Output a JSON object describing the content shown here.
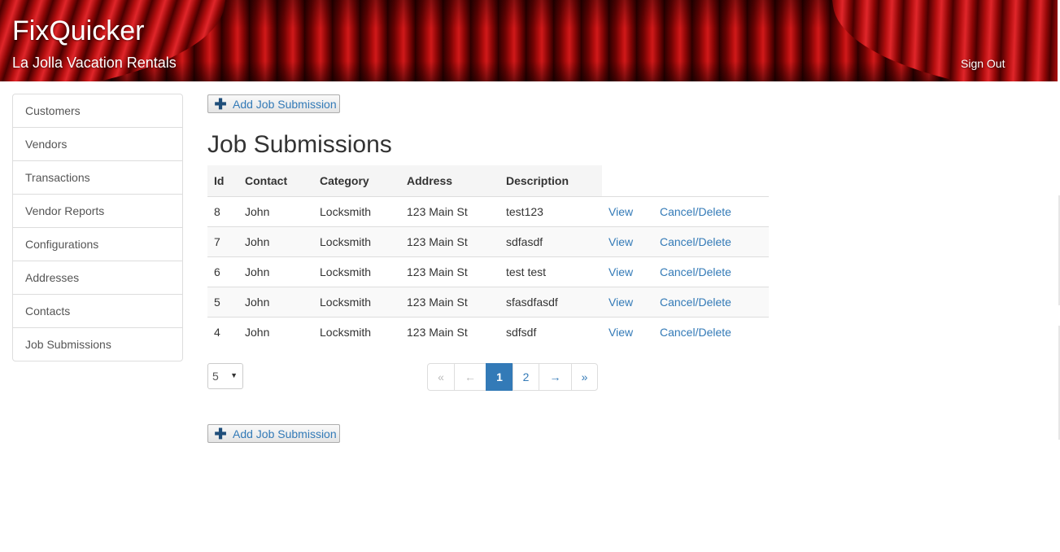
{
  "header": {
    "brand": "FixQuicker",
    "subtitle": "La Jolla Vacation Rentals",
    "signout_label": "Sign Out"
  },
  "sidebar": {
    "items": [
      {
        "label": "Customers"
      },
      {
        "label": "Vendors"
      },
      {
        "label": "Transactions"
      },
      {
        "label": "Vendor Reports"
      },
      {
        "label": "Configurations"
      },
      {
        "label": "Addresses"
      },
      {
        "label": "Contacts"
      },
      {
        "label": "Job Submissions"
      }
    ]
  },
  "main": {
    "add_button_label": "Add Job Submission",
    "title": "Job Submissions",
    "table": {
      "columns": [
        "Id",
        "Contact",
        "Category",
        "Address",
        "Description"
      ],
      "rows": [
        {
          "id": "8",
          "contact": "John",
          "category": "Locksmith",
          "address": "123 Main St",
          "description": "test123",
          "view": "View",
          "delete": "Cancel/Delete"
        },
        {
          "id": "7",
          "contact": "John",
          "category": "Locksmith",
          "address": "123 Main St",
          "description": "sdfasdf",
          "view": "View",
          "delete": "Cancel/Delete"
        },
        {
          "id": "6",
          "contact": "John",
          "category": "Locksmith",
          "address": "123 Main St",
          "description": "test test",
          "view": "View",
          "delete": "Cancel/Delete"
        },
        {
          "id": "5",
          "contact": "John",
          "category": "Locksmith",
          "address": "123 Main St",
          "description": "sfasdfasdf",
          "view": "View",
          "delete": "Cancel/Delete"
        },
        {
          "id": "4",
          "contact": "John",
          "category": "Locksmith",
          "address": "123 Main St",
          "description": "sdfsdf",
          "view": "View",
          "delete": "Cancel/Delete"
        }
      ]
    },
    "page_size": {
      "selected": "5",
      "caret_icon": "chevron-down-icon"
    },
    "pagination": {
      "first": "«",
      "prev": "←",
      "pages": [
        "1",
        "2"
      ],
      "current_page": "1",
      "next": "→",
      "last": "»"
    }
  },
  "colors": {
    "link": "#337ab7",
    "active_page": "#337ab7",
    "header_red": "#b20d0d"
  }
}
